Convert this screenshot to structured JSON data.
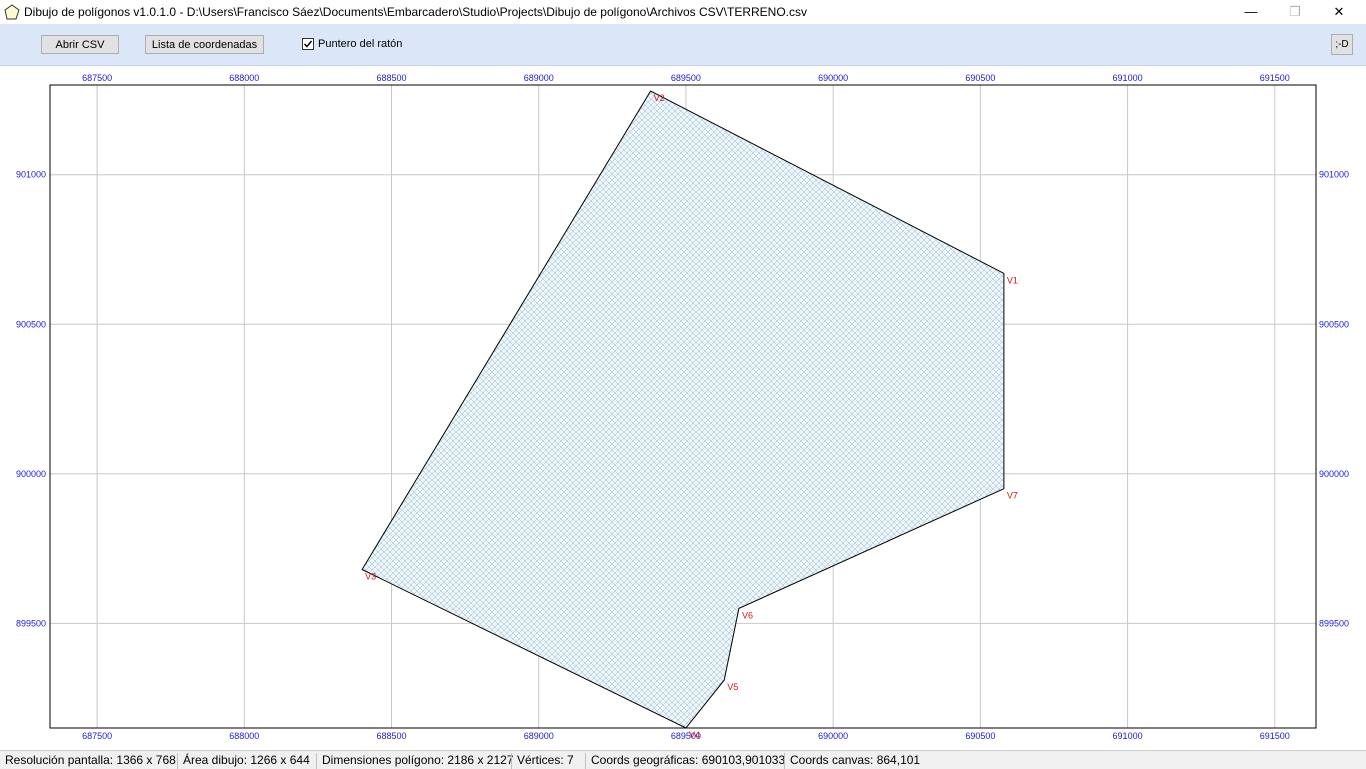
{
  "window": {
    "title": "Dibujo de polígonos v1.0.1.0  -  D:\\Users\\Francisco Sáez\\Documents\\Embarcadero\\Studio\\Projects\\Dibujo de polígono\\Archivos CSV\\TERRENO.csv",
    "minimize_glyph": "—",
    "maximize_glyph": "❐",
    "close_glyph": "✕"
  },
  "toolbar": {
    "open_csv_label": "Abrir CSV",
    "coord_list_label": "Lista de coordenadas",
    "mouse_pointer_label": "Puntero del ratón",
    "mouse_pointer_checked": true,
    "corner_button_label": ";-D"
  },
  "plot": {
    "x_ticks": [
      "687500",
      "688000",
      "688500",
      "689000",
      "689500",
      "690000",
      "690500",
      "691000",
      "691500"
    ],
    "y_ticks": [
      "901000",
      "900500",
      "900000",
      "899500"
    ],
    "x_range": [
      687340,
      691640
    ],
    "y_range": [
      899150,
      901300
    ],
    "colors": {
      "tick_label": "#1a1adb",
      "vertex_label": "#e01010",
      "grid": "#c8c8c8",
      "hatch": "#8fb8d6",
      "fill": "#eef5f9"
    },
    "vertices": [
      {
        "label": "V1",
        "x": 690580,
        "y": 900670
      },
      {
        "label": "V2",
        "x": 689380,
        "y": 901280
      },
      {
        "label": "V3",
        "x": 688400,
        "y": 899680
      },
      {
        "label": "V4",
        "x": 689500,
        "y": 899150
      },
      {
        "label": "V5",
        "x": 689630,
        "y": 899310
      },
      {
        "label": "V6",
        "x": 689680,
        "y": 899550
      },
      {
        "label": "V7",
        "x": 690580,
        "y": 899950
      }
    ]
  },
  "status": {
    "screen_resolution": "Resolución pantalla: 1366 x 768",
    "drawing_area": "Área dibujo: 1266 x 644",
    "polygon_dimensions": "Dimensiones polígono: 2186 x 2127",
    "vertices": "Vértices: 7",
    "geo_coords": "Coords geográficas: 690103,901033",
    "canvas_coords": "Coords canvas: 864,101"
  }
}
